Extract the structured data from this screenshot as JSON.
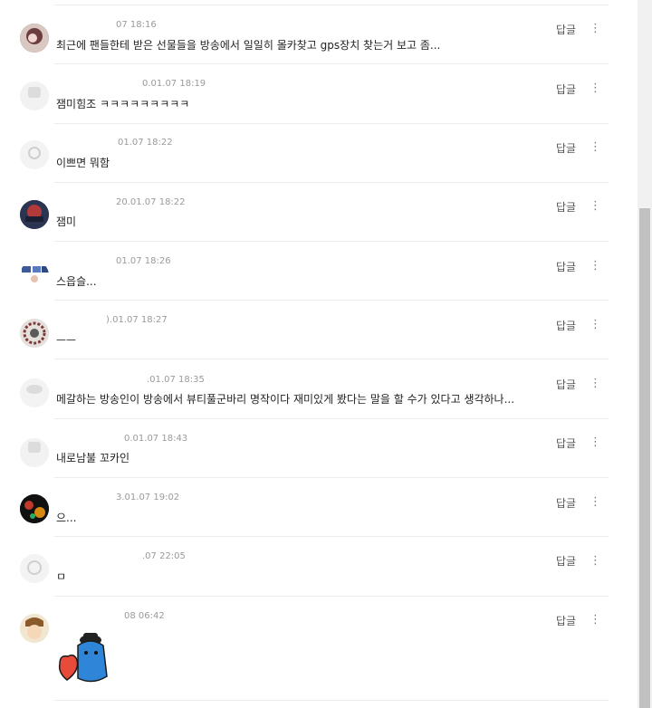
{
  "comments": [
    {
      "time": "07 18:16",
      "text": "최근에 팬들한테 받은 선물들을 방송에서 일일히 몰카찾고 gps장치 찾는거 보고 좀...",
      "reply": "답글"
    },
    {
      "time": "0.01.07 18:19",
      "text": "잼미힘조 ㅋㅋㅋㅋㅋㅋㅋㅋㅋ",
      "reply": "답글"
    },
    {
      "time": "01.07 18:22",
      "text": "이쁘면 뭐함",
      "reply": "답글"
    },
    {
      "time": "20.01.07 18:22",
      "text": "잼미",
      "reply": "답글"
    },
    {
      "time": "01.07 18:26",
      "text": "스읍슬...",
      "reply": "답글"
    },
    {
      "time": ").01.07 18:27",
      "text": "ㅡㅡ",
      "reply": "답글"
    },
    {
      "time": ".01.07 18:35",
      "text": "메갈하는 방송인이 방송에서 뷰티풀군바리 명작이다 재미있게 봤다는 말을 할 수가 있다고 생각하나...",
      "reply": "답글"
    },
    {
      "time": "0.01.07 18:43",
      "text": "내로남불 꼬카인",
      "reply": "답글"
    },
    {
      "time": "3.01.07 19:02",
      "text": "으...",
      "reply": "답글"
    },
    {
      "time": ".07 22:05",
      "text": "ㅁ",
      "reply": "답글"
    },
    {
      "time": "08 06:42",
      "text": "",
      "reply": "답글"
    }
  ],
  "more_glyph": "⋮",
  "colors": {
    "divider": "#ececec",
    "meta": "#9a9a9a",
    "sticker_blue": "#2f86d8",
    "sticker_heart": "#e84b3a"
  }
}
